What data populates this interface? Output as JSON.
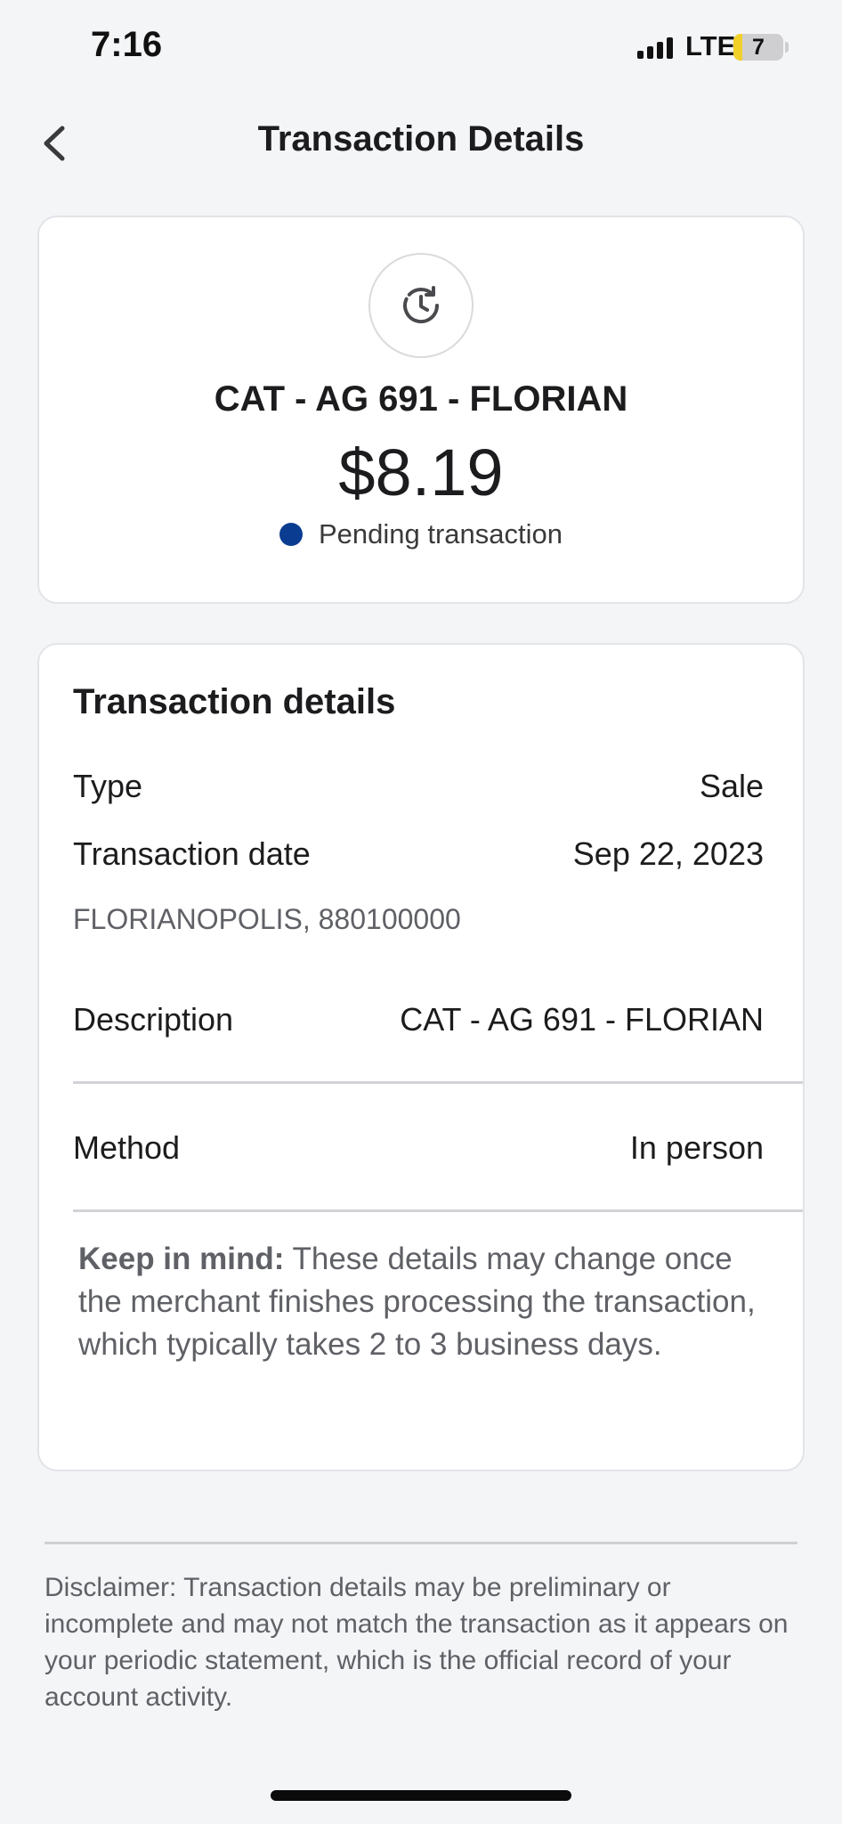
{
  "status_bar": {
    "time": "7:16",
    "network": "LTE",
    "battery_level": "7",
    "battery_fill_fraction": 0.07
  },
  "nav": {
    "title": "Transaction Details",
    "back_icon": "chevron-left-icon"
  },
  "summary": {
    "status_icon": "clock-pending-icon",
    "merchant": "CAT - AG 691 - FLORIAN",
    "amount": "$8.19",
    "status_text": "Pending transaction",
    "status_color": "#0a3d91"
  },
  "details": {
    "heading": "Transaction details",
    "type_label": "Type",
    "type_value": "Sale",
    "date_label": "Transaction date",
    "date_value": "Sep 22, 2023",
    "location": "FLORIANOPOLIS, 880100000",
    "description_label": "Description",
    "description_value": "CAT - AG 691 - FLORIAN",
    "method_label": "Method",
    "method_value": "In person",
    "note_lead": "Keep in mind:",
    "note_body": " These details may change once the merchant finishes processing the transaction, which typically takes 2 to 3 business days."
  },
  "footer": {
    "disclaimer": "Disclaimer: Transaction details may be preliminary or incomplete and may not match the transaction as it appears on your periodic statement, which is the official record of your account activity."
  }
}
